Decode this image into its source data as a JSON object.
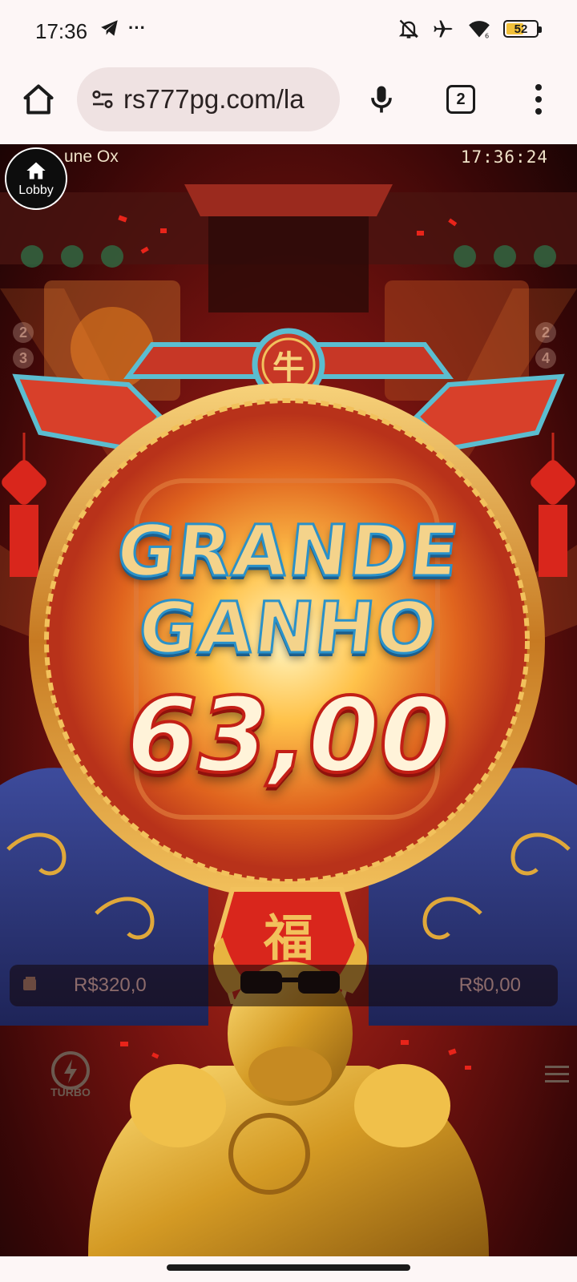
{
  "status_bar": {
    "time": "17:36",
    "more": "···",
    "battery": "52"
  },
  "browser": {
    "url": "rs777pg.com/la",
    "tab_count": "2"
  },
  "game": {
    "title": "une Ox",
    "clock": "17:36:24",
    "lobby_label": "Lobby",
    "left_reel_numbers": [
      "2",
      "3"
    ],
    "right_reel_numbers": [
      "2",
      "4"
    ],
    "win_line1": "GRANDE",
    "win_line2": "GANHO",
    "win_amount": "63,00",
    "fu_character": "福",
    "niu_character": "牛",
    "balance_left": "R$320,0",
    "balance_right": "R$0,00",
    "turbo_label": "TURBO",
    "colors": {
      "banner_text": "#f4d38b",
      "banner_outline": "#2a91c9",
      "amount_outline": "#c31f16",
      "gold": "#e0a83a",
      "red": "#c5331e"
    }
  }
}
